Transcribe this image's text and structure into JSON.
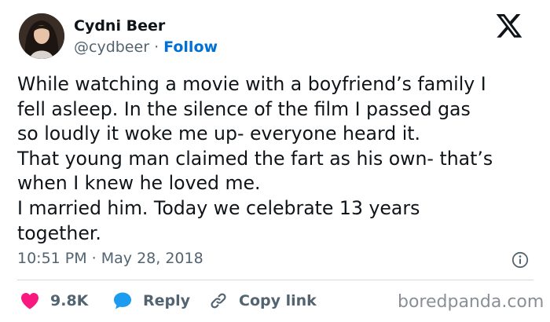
{
  "author": {
    "name": "Cydni Beer",
    "handle": "@cydbeer",
    "separator": "·",
    "follow_label": "Follow"
  },
  "tweet": {
    "lines": [
      "While watching a movie with a boyfriend’s family I",
      "fell asleep. In the silence of the film I passed gas",
      "so loudly it woke me up- everyone heard it.",
      "That young man claimed the fart as his own- that’s",
      "when I knew he loved me.",
      "I married him. Today we celebrate 13 years",
      "together."
    ],
    "timestamp": "10:51 PM · May 28, 2018"
  },
  "actions": {
    "like_count": "9.8K",
    "reply_label": "Reply",
    "copy_label": "Copy link"
  },
  "watermark": "boredpanda.com",
  "colors": {
    "accent": "#006fd6",
    "heart": "#f91880",
    "reply_bubble": "#1d9bf0",
    "secondary_text": "#536471",
    "divider": "#cfd9de"
  },
  "icons": [
    "x-logo-icon",
    "info-icon",
    "heart-icon",
    "reply-bubble-icon",
    "link-icon"
  ]
}
